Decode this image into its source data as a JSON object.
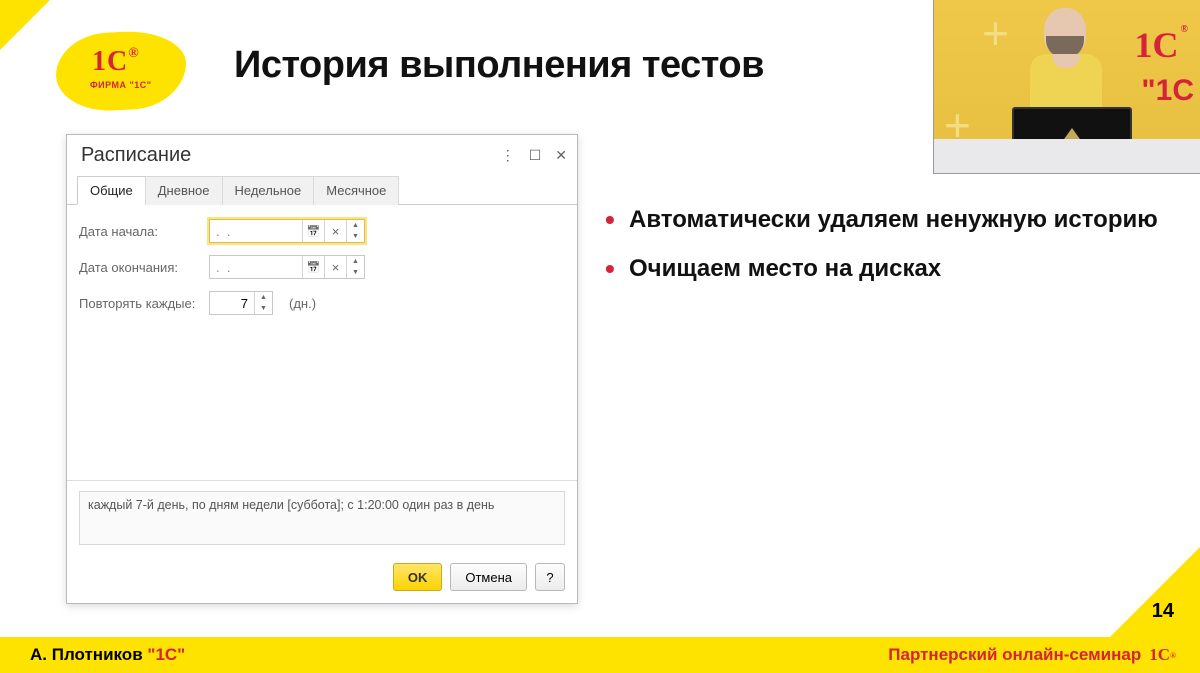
{
  "slide": {
    "title": "История выполнения тестов",
    "page_number": "14",
    "bullets": [
      "Автоматически удаляем ненужную историю",
      "Очищаем место на дисках"
    ]
  },
  "logo": {
    "main": "1C",
    "reg": "®",
    "sub": "ФИРМА \"1С\""
  },
  "footer": {
    "speaker": "А. Плотников",
    "org": "\"1С\"",
    "event": "Партнерский онлайн-семинар",
    "footer_logo": "1C"
  },
  "dialog": {
    "title": "Расписание",
    "tabs": [
      "Общие",
      "Дневное",
      "Недельное",
      "Месячное"
    ],
    "active_tab_index": 0,
    "labels": {
      "start": "Дата начала:",
      "end": "Дата окончания:",
      "repeat": "Повторять каждые:",
      "unit": "(дн.)"
    },
    "values": {
      "start_date": ".  .",
      "end_date": ".  .",
      "repeat_days": "7"
    },
    "summary": "каждый 7-й день, по дням недели [суббота]; с 1:20:00 один раз в день",
    "buttons": {
      "ok": "OK",
      "cancel": "Отмена",
      "help": "?"
    },
    "window_actions": {
      "more": "⋮",
      "max": "☐",
      "close": "✕"
    }
  },
  "webcam": {
    "wall_logo": "1C",
    "wall_sub": "\"1C"
  }
}
